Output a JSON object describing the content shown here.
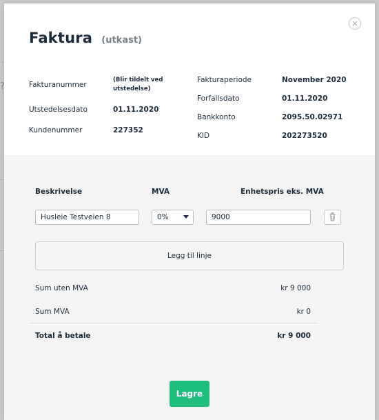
{
  "modal": {
    "close_label": "×",
    "title": "Faktura",
    "subtitle": "(utkast)"
  },
  "invoice_meta": {
    "left": [
      {
        "label": "Fakturanummer",
        "value_line1": "(Blir tildelt ved",
        "value_line2": "utstedelse)"
      },
      {
        "label": "Utstedelsesdato",
        "value": "01.11.2020"
      },
      {
        "label": "Kundenummer",
        "value": "227352"
      }
    ],
    "right": [
      {
        "label": "Fakturaperiode",
        "value": "November 2020"
      },
      {
        "label": "Forfallsdato",
        "value": "01.11.2020"
      },
      {
        "label": "Bankkonto",
        "value": "2095.50.02971"
      },
      {
        "label": "KID",
        "value": "202273520"
      }
    ]
  },
  "lines": {
    "headers": {
      "description": "Beskrivelse",
      "vat": "MVA",
      "unit_price": "Enhetspris eks. MVA"
    },
    "rows": [
      {
        "description": "Husleie Testveien 8",
        "vat": "0%",
        "unit_price": "9000"
      }
    ],
    "add_line_label": "Legg til linje"
  },
  "totals": {
    "sum_ex_vat_label": "Sum uten MVA",
    "sum_ex_vat_value": "kr 9 000",
    "vat_label": "Sum MVA",
    "vat_value": "kr 0",
    "total_label": "Total å betale",
    "total_value": "kr 9 000"
  },
  "actions": {
    "save_label": "Lagre"
  },
  "colors": {
    "primary": "#1ebd7c",
    "text": "#1c2b3a",
    "muted": "#777f87",
    "panel_bg": "#f4f4f4"
  },
  "icons": {
    "close": "close-icon",
    "delete": "trash-icon",
    "select": "chevron-down-icon"
  }
}
